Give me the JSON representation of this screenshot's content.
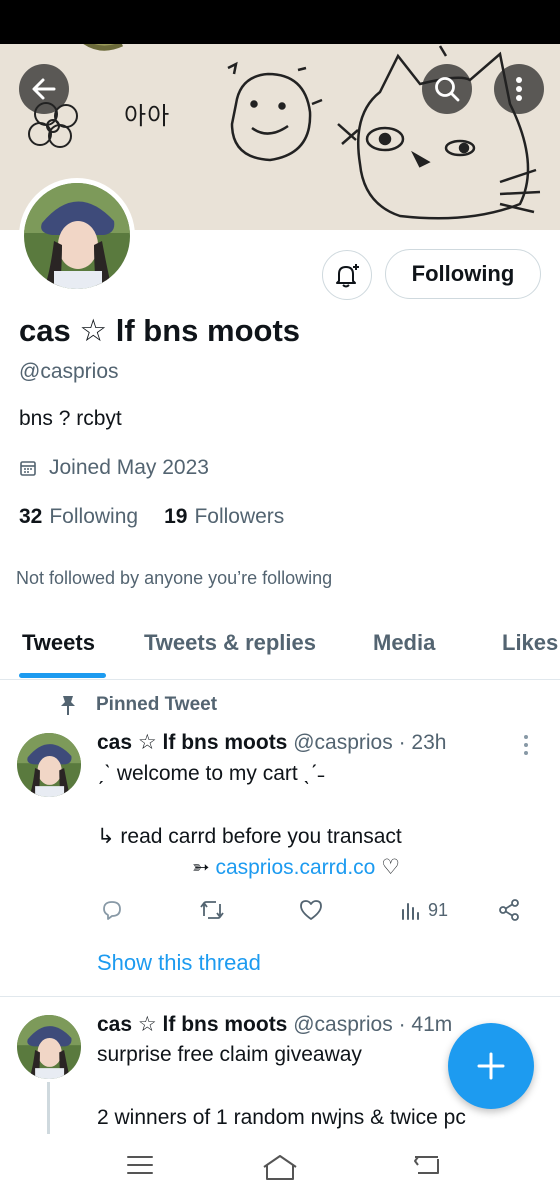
{
  "profile": {
    "display_name": "cas ☆ lf bns moots",
    "handle": "@casprios",
    "bio": "bns ? rcbyt",
    "joined": "Joined May 2023",
    "following_count": "32",
    "following_label": "Following",
    "followers_count": "19",
    "followers_label": "Followers",
    "not_followed_note": "Not followed by anyone you’re following"
  },
  "banner": {
    "doodle_text": "아아"
  },
  "buttons": {
    "following_label": "Following"
  },
  "tabs": [
    {
      "label": "Tweets",
      "active": true
    },
    {
      "label": "Tweets & replies",
      "active": false
    },
    {
      "label": "Media",
      "active": false
    },
    {
      "label": "Likes",
      "active": false
    }
  ],
  "pinned_label": "Pinned Tweet",
  "tweets": [
    {
      "name": "cas ☆ lf bns moots",
      "meta": "@casprios · 23h",
      "line1": "ˏˋ welcome to my cart ˎˊ˗",
      "line2": "↳ read carrd before you transact",
      "line3_prefix": "➳",
      "link": "casprios.carrd.co",
      "line3_suffix": "♡",
      "views": "91",
      "show_thread": "Show this thread"
    },
    {
      "name": "cas ☆ lf bns moots",
      "meta": "@casprios · 41m",
      "line1": "surprise free claim giveaway",
      "line2": "2 winners of 1 random nwjns & twice pc"
    }
  ],
  "colors": {
    "accent": "#1d9bf0",
    "text": "#0f1419",
    "secondary": "#536471"
  },
  "icons": [
    "back-arrow-icon",
    "search-icon",
    "more-vertical-icon",
    "bell-plus-icon",
    "calendar-icon",
    "pin-icon",
    "reply-icon",
    "retweet-icon",
    "like-icon",
    "views-icon",
    "share-icon",
    "plus-icon",
    "menu-icon",
    "home-icon",
    "back-nav-icon"
  ]
}
